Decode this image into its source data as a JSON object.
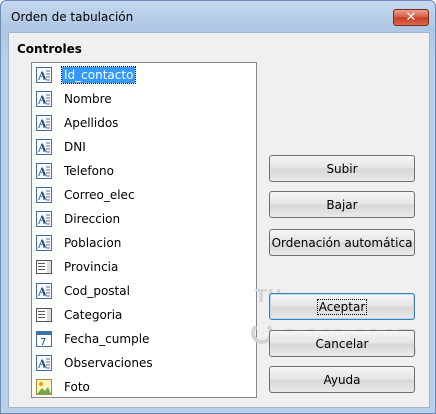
{
  "window": {
    "title": "Orden de tabulación",
    "close_glyph": "✕"
  },
  "section_label": "Controles",
  "list": {
    "items": [
      {
        "label": "Id_contacto",
        "icon": "text-field-icon",
        "selected": true
      },
      {
        "label": "Nombre",
        "icon": "text-field-icon",
        "selected": false
      },
      {
        "label": "Apellidos",
        "icon": "text-field-icon",
        "selected": false
      },
      {
        "label": "DNI",
        "icon": "text-field-icon",
        "selected": false
      },
      {
        "label": "Telefono",
        "icon": "text-field-icon",
        "selected": false
      },
      {
        "label": "Correo_elec",
        "icon": "text-field-icon",
        "selected": false
      },
      {
        "label": "Direccion",
        "icon": "text-field-icon",
        "selected": false
      },
      {
        "label": "Poblacion",
        "icon": "text-field-icon",
        "selected": false
      },
      {
        "label": "Provincia",
        "icon": "list-box-icon",
        "selected": false
      },
      {
        "label": "Cod_postal",
        "icon": "text-field-icon",
        "selected": false
      },
      {
        "label": "Categoria",
        "icon": "list-box-icon",
        "selected": false
      },
      {
        "label": "Fecha_cumple",
        "icon": "date-field-icon",
        "selected": false
      },
      {
        "label": "Observaciones",
        "icon": "text-field-icon",
        "selected": false
      },
      {
        "label": "Foto",
        "icon": "image-control-icon",
        "selected": false
      }
    ]
  },
  "buttons": {
    "subir": "Subir",
    "bajar": "Bajar",
    "automatica": "Ordenación automática",
    "aceptar": "Aceptar",
    "cancelar": "Cancelar",
    "ayuda": "Ayuda"
  },
  "watermark": {
    "line1": "TU",
    "line2": "INSTITUTO",
    "line3": "ONLINE"
  },
  "colors": {
    "selection": "#3399ff",
    "close_button": "#c53e25",
    "title_bar": "#b9d0ea"
  }
}
